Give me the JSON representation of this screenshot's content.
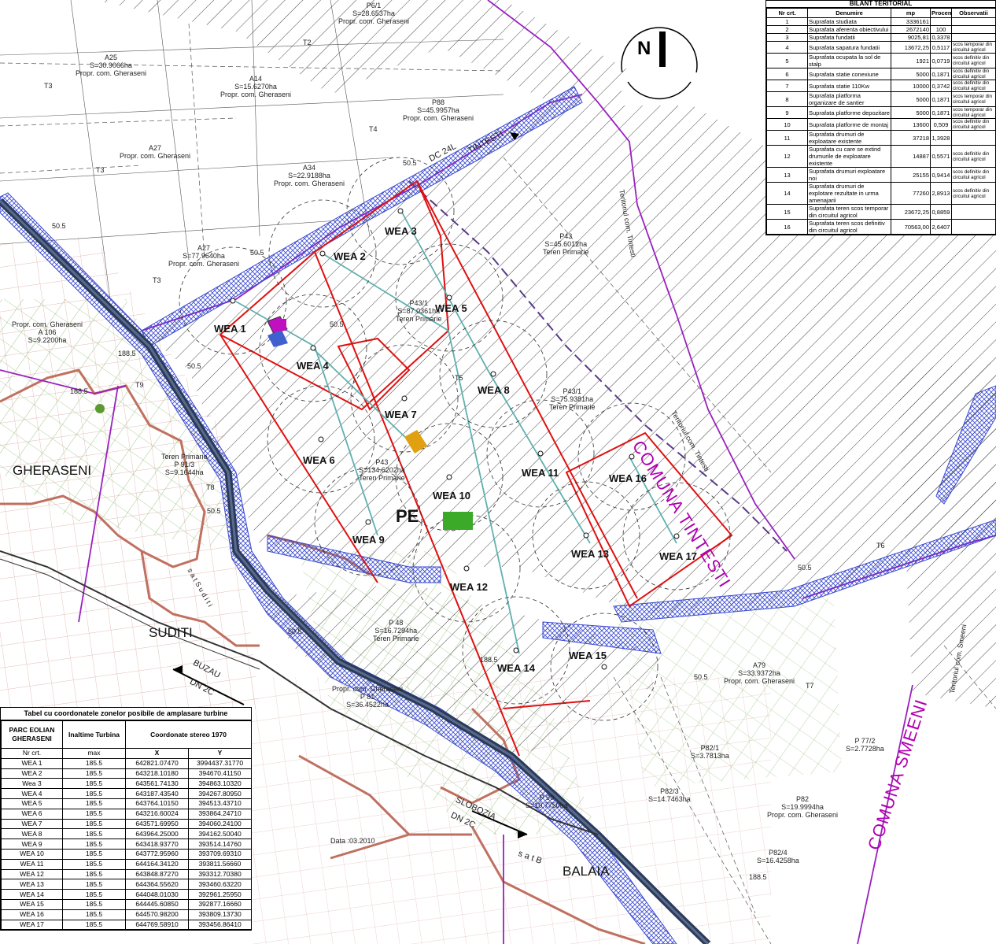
{
  "north_label": "N",
  "places": {
    "gheraseni": "GHERASENI",
    "suditi": "SUDITI",
    "balaia": "BALAIA",
    "comuna_tintesti": "COMUNA TINTESTI",
    "comuna_smeeni": "COMUNA SMEENI",
    "pe": "PE",
    "buzau": "BUZAU",
    "dn2c_left": "DN 2C",
    "slobozia": "SLOBOZIA",
    "dn2c_right": "DN 2C",
    "dc24l": "DC 24L",
    "tintesti_road": "TINTESTI",
    "teritoriul_tintesti_1": "Teritoriul com. Tintesti",
    "teritoriul_tintesti_2": "Teritoriul com. Tintesti",
    "teritoriul_smeeni": "Teritoriul com. Smeeni",
    "sat_suditi": "s a t   S u d i t i",
    "sat_balaia": "s a t   B"
  },
  "date_note": "Data :03.2010",
  "turbines": [
    "WEA 1",
    "WEA 2",
    "WEA 3",
    "WEA 4",
    "WEA 5",
    "WEA 6",
    "WEA 7",
    "WEA 8",
    "WEA 9",
    "WEA 10",
    "WEA 11",
    "WEA 12",
    "WEA 13",
    "WEA 14",
    "WEA 15",
    "WEA 16",
    "WEA 17"
  ],
  "parcels": {
    "a25": [
      "A25",
      "S=30.9066ha",
      "Propr. com. Gheraseni"
    ],
    "a14": [
      "A14",
      "S=15.6270ha",
      "Propr. com. Gheraseni"
    ],
    "a27a": [
      "A27",
      "Propr. com. Gheraseni"
    ],
    "a34": [
      "A34",
      "S=22.9188ha",
      "Propr. com. Gheraseni"
    ],
    "a27b": [
      "A27",
      "S=77.9640ha",
      "Propr. com. Gheraseni"
    ],
    "p11": [
      "P6/1",
      "S=28.6537ha",
      "Propr. com. Gheraseni"
    ],
    "p88": [
      "P88",
      "S=45.9957ha",
      "Propr. com. Gheraseni"
    ],
    "p43": [
      "P43",
      "S=45.6012ha",
      "Teren Primarie"
    ],
    "p431": [
      "P43/1",
      "S=87.0361ha",
      "Teren Primarie"
    ],
    "p431b": [
      "P43/1",
      "S=75.9381ha",
      "Teren Primarie"
    ],
    "p43c": [
      "P43",
      "S=134.6202ha",
      "Teren Primarie"
    ],
    "a79": [
      "A79",
      "S=33.9372ha",
      "Propr. com. Gheraseni"
    ],
    "p82": [
      "P82",
      "S=19.9994ha",
      "Propr. com. Gheraseni"
    ],
    "p821": [
      "P82/1",
      "S=3.7813ha"
    ],
    "p772": [
      "P 77/2",
      "S=2.7728ha"
    ],
    "p913": [
      "Teren Primarie",
      "P 91/3",
      "S=9.1644ha"
    ],
    "a106": [
      "Propr. com. Gheraseni",
      "A 106",
      "S=9.2200ha"
    ],
    "p811": [
      "Propr. com. Gheraseni",
      "P 81",
      "S=36.4522ha"
    ],
    "p48": [
      "P 48",
      "S=16.7294ha",
      "Teren Primarie"
    ],
    "p90": [
      "P 90",
      "S=10.7750ha"
    ],
    "p823": [
      "P82/3",
      "S=14.7463ha"
    ],
    "p824": [
      "P82/4",
      "S=16.4258ha"
    ],
    "t3a": "T3",
    "t3b": "T3",
    "t3c": "T3",
    "t2": "T2",
    "t4": "T4",
    "t5": "T5",
    "t6": "T6",
    "t7": "T7",
    "t8": "T8",
    "t9": "T9"
  },
  "dist_labels": [
    "50.5",
    "50.5",
    "50.5",
    "50.5",
    "50.5",
    "50.5",
    "188.5",
    "188.5",
    "188.5",
    "50.5",
    "50.5",
    "50.5",
    "188.5"
  ],
  "bilant": {
    "title": "BILANT TERITORIAL",
    "headers": [
      "Nr crt.",
      "Denumire",
      "mp",
      "Procent",
      "Observatii"
    ],
    "rows": [
      [
        "1",
        "Suprafata studiata",
        "3336161",
        "",
        ""
      ],
      [
        "2",
        "Suprafata aferenta obiectivului",
        "2672140",
        "100",
        ""
      ],
      [
        "3",
        "Suprafata fundatii",
        "9025,81",
        "0,3378",
        ""
      ],
      [
        "4",
        "Suprafata sapatura fundatii",
        "13672,25",
        "0,5117",
        "scos temporar din circuitul agricol"
      ],
      [
        "5",
        "Suprafata ocupata la sol de stalp",
        "1921",
        "0,0719",
        "scos definitiv din circuitul agricol"
      ],
      [
        "6",
        "Suprafata statie conexiune",
        "5000",
        "0,1871",
        "scos definitiv din circuitul agricol"
      ],
      [
        "7",
        "Suprafata statie 110Kw",
        "10000",
        "0,3742",
        "scos definitiv din circuitul agricol"
      ],
      [
        "8",
        "Suprafata platforma organizare de santier",
        "5000",
        "0,1871",
        "scos temporar din circuitul agricol"
      ],
      [
        "9",
        "Suprafata platforme depozitare",
        "5000",
        "0,1871",
        "scos temporar din circuitul agricol"
      ],
      [
        "10",
        "Suprafata platforme de montaj",
        "13600",
        "0,509",
        "scos definitiv din circuitul agricol"
      ],
      [
        "11",
        "Suprafata drumuri de exploatare existente",
        "37218",
        "1,3928",
        ""
      ],
      [
        "12",
        "Suprafata cu care se extind drumurile de exploatare existente",
        "14887",
        "0,5571",
        "scos definitiv din circuitul agricol"
      ],
      [
        "13",
        "Suprafata drumuri exploatare noi",
        "25155",
        "0,9414",
        "scos definitiv din circuitul agricol"
      ],
      [
        "14",
        "Suprafata drumuri de explotare rezultate in urma amenajarii",
        "77260",
        "2,8913",
        "scos definitiv din circuitul agricol"
      ],
      [
        "15",
        "Suprafata teren scos temporar din circuitul agricol",
        "23672,25",
        "0,8859",
        ""
      ],
      [
        "16",
        "Suprafata teren scos definitiv din circuitul agricol",
        "70563,00",
        "2,6407",
        ""
      ]
    ]
  },
  "coord": {
    "title": "Tabel cu coordonatele zonelor posibile de amplasare turbine",
    "h_parc": "PARC EOLIAN GHERASENI",
    "h_inaltime": "Inaltime Turbina",
    "h_coord": "Coordonate stereo 1970",
    "h_nr": "Nr crt.",
    "h_max": "max",
    "h_x": "X",
    "h_y": "Y",
    "rows": [
      [
        "WEA 1",
        "185.5",
        "642821.07470",
        "3994437.31770"
      ],
      [
        "WEA 2",
        "185.5",
        "643218.10180",
        "394670.41150"
      ],
      [
        "Wea 3",
        "185.5",
        "643561.74130",
        "394863.10320"
      ],
      [
        "WEA 4",
        "185.5",
        "643187.43540",
        "394267.80950"
      ],
      [
        "WEA 5",
        "185.5",
        "643764.10150",
        "394513.43710"
      ],
      [
        "WEA 6",
        "185.5",
        "643216.60024",
        "393864.24710"
      ],
      [
        "WEA 7",
        "185.5",
        "643571.69950",
        "394060.24100"
      ],
      [
        "WEA 8",
        "185.5",
        "643964.25000",
        "394162.50040"
      ],
      [
        "WEA 9",
        "185.5",
        "643418.93770",
        "393514.14760"
      ],
      [
        "WEA 10",
        "185.5",
        "643772.95960",
        "393709.69310"
      ],
      [
        "WEA 11",
        "185.5",
        "644164.34120",
        "393811.56660"
      ],
      [
        "WEA 12",
        "185.5",
        "643848.87270",
        "393312.70380"
      ],
      [
        "WEA 13",
        "185.5",
        "644364.55620",
        "393460.63220"
      ],
      [
        "WEA 14",
        "185.5",
        "644048.01030",
        "392961.25950"
      ],
      [
        "WEA 15",
        "185.5",
        "644445.60850",
        "392877.16660"
      ],
      [
        "WEA 16",
        "185.5",
        "644570.98200",
        "393809.13730"
      ],
      [
        "WEA 17",
        "185.5",
        "644769.58910",
        "393456.86410"
      ]
    ]
  },
  "colors": {
    "road_dark": "#2a3a5a",
    "hatch_blue": "#3a4ad0",
    "red_boundary": "#e01010",
    "purple_boundary": "#9a20c0",
    "magenta_text": "#b000b0",
    "brown_village": "#c07060",
    "green_grid": "#6aa040",
    "cyan_cable": "#60b0b0",
    "substation": "#3aaa28",
    "platform_orange": "#e0a010",
    "platform_magenta": "#c010c0",
    "platform_blue": "#4060d0"
  }
}
